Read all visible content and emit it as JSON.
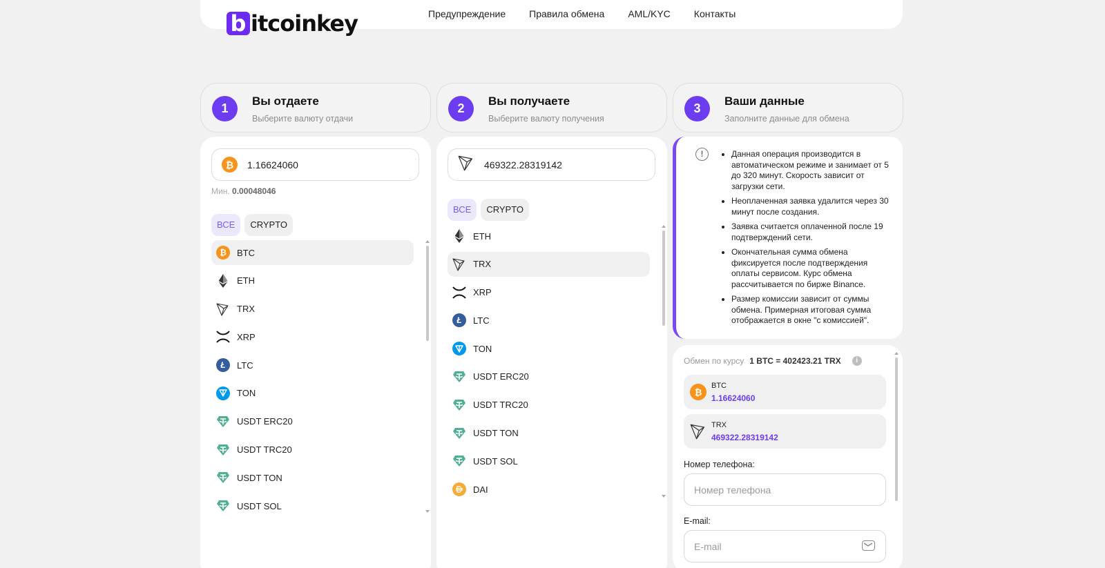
{
  "brand": {
    "logo_letter": "b",
    "logo_rest": "itcoinkey"
  },
  "nav": [
    "Предупреждение",
    "Правила обмена",
    "AML/KYC",
    "Контакты"
  ],
  "steps": [
    {
      "num": "1",
      "title": "Вы отдаете",
      "subtitle": "Выберите валюту отдачи"
    },
    {
      "num": "2",
      "title": "Вы получаете",
      "subtitle": "Выберите валюту получения"
    },
    {
      "num": "3",
      "title": "Ваши данные",
      "subtitle": "Заполните данные для обмена"
    }
  ],
  "give": {
    "amount": "1.16624060",
    "min_label": "Мин.",
    "min_value": "0.00048046",
    "filters": [
      "ВСЕ",
      "CRYPTO"
    ],
    "selected": "BTC",
    "coins": [
      "BTC",
      "ETH",
      "TRX",
      "XRP",
      "LTC",
      "TON",
      "USDT ERC20",
      "USDT TRC20",
      "USDT TON",
      "USDT SOL"
    ]
  },
  "get": {
    "amount": "469322.28319142",
    "filters": [
      "ВСЕ",
      "CRYPTO"
    ],
    "selected": "TRX",
    "coins": [
      "ETH",
      "TRX",
      "XRP",
      "LTC",
      "TON",
      "USDT ERC20",
      "USDT TRC20",
      "USDT TON",
      "USDT SOL",
      "DAI"
    ]
  },
  "notice": {
    "icon": "!",
    "items": [
      "Данная операция производится в автоматическом режиме и занимает от 5 до 320 минут. Скорость зависит от загрузки сети.",
      "Неоплаченная заявка удалится через 30 минут после создания.",
      "Заявка считается оплаченной после 19 подтверждений сети.",
      "Окончательная сумма обмена фиксируется после подтверждения оплаты сервисом. Курс обмена рассчитывается по бирже Binance.",
      "Размер комиссии зависит от суммы обмена. Примерная итоговая сумма отображается в окне \"с комиссией\"."
    ]
  },
  "summary": {
    "rate_label": "Обмен по курсу",
    "rate_value": "1 BTC = 402423.21 TRX",
    "info_icon": "i",
    "give_currency": "BTC",
    "give_amount": "1.16624060",
    "get_currency": "TRX",
    "get_amount": "469322.28319142",
    "phone_label": "Номер телефона:",
    "phone_placeholder": "Номер телефона",
    "email_label": "E-mail:",
    "email_placeholder": "E-mail"
  },
  "colors": {
    "accent": "#6c3df0",
    "btc": "#f7931a",
    "ltc": "#345d9d",
    "ton": "#0098ea",
    "usdt": "#50af95",
    "dai": "#f5ac37"
  },
  "coin_icons": {
    "BTC": "bitcoin-icon",
    "ETH": "ethereum-icon",
    "TRX": "tron-icon",
    "XRP": "xrp-icon",
    "LTC": "litecoin-icon",
    "TON": "ton-icon",
    "USDT ERC20": "tether-icon",
    "USDT TRC20": "tether-icon",
    "USDT TON": "tether-icon",
    "USDT SOL": "tether-icon",
    "DAI": "dai-icon"
  }
}
